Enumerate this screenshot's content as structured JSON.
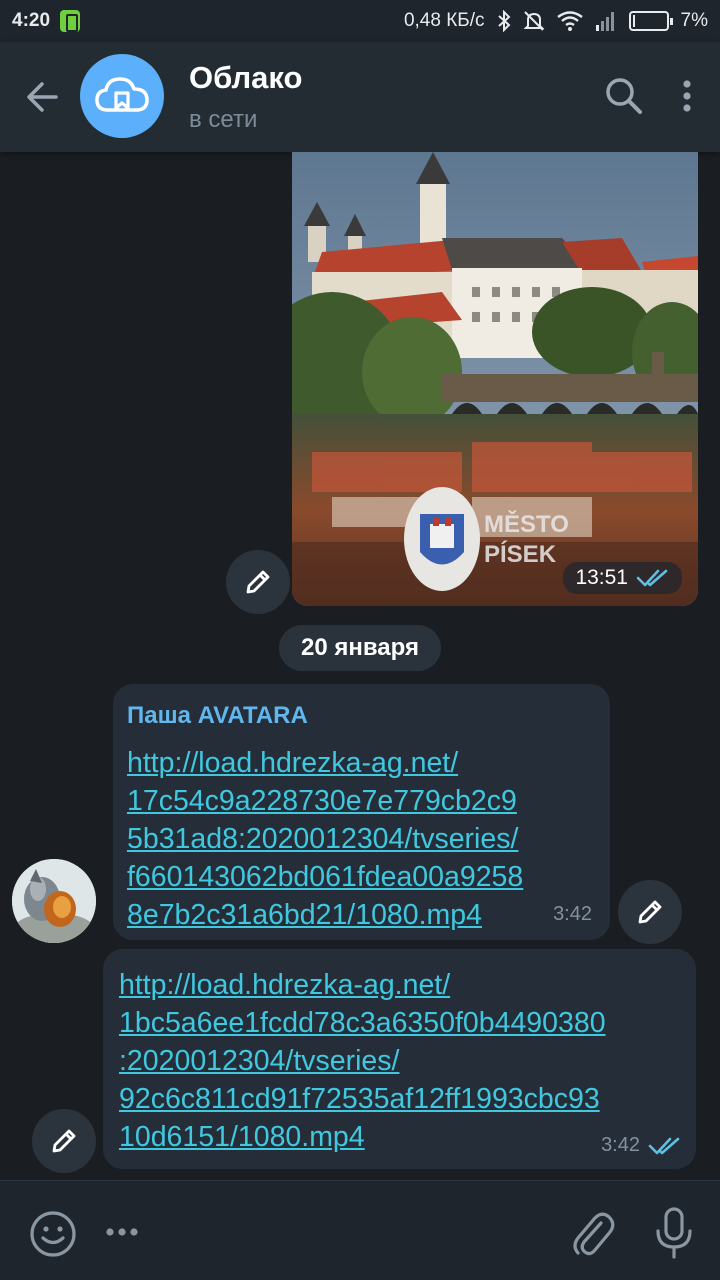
{
  "status_bar": {
    "time": "4:20",
    "network_speed": "0,48 КБ/с",
    "battery_percent": "7%",
    "battery_level": 0.07
  },
  "header": {
    "title": "Облако",
    "subtitle": "в сети"
  },
  "photo_message": {
    "watermark_line1": "MĚSTO",
    "watermark_line2": "PÍSEK",
    "time": "13:51",
    "read_receipt_icon": "double-check-icon"
  },
  "date_separator": "20 января",
  "messages": [
    {
      "sender": "Паша AVATARA",
      "link_lines": [
        "http://load.hdrezka-ag.net/",
        "17c54c9a228730e7e779cb2c9",
        "5b31ad8:2020012304/tvseries/",
        "f660143062bd061fdea00a9258",
        "8e7b2c31a6bd21/1080.mp4"
      ],
      "time": "3:42"
    },
    {
      "link_lines": [
        "http://load.hdrezka-ag.net/",
        "1bc5a6ee1fcdd78c3a6350f0b4490380",
        ":2020012304/tvseries/",
        "92c6c811cd91f72535af12ff1993cbc93",
        "10d6151/1080.mp4"
      ],
      "time": "3:42",
      "read_receipt_icon": "double-check-icon"
    }
  ],
  "colors": {
    "background": "#1a1e23",
    "header": "#232b33",
    "bubble": "#252e38",
    "link": "#3fc8e0",
    "sender": "#61b6ed",
    "check": "#5ec0e0",
    "avatar": "#5caffa"
  }
}
